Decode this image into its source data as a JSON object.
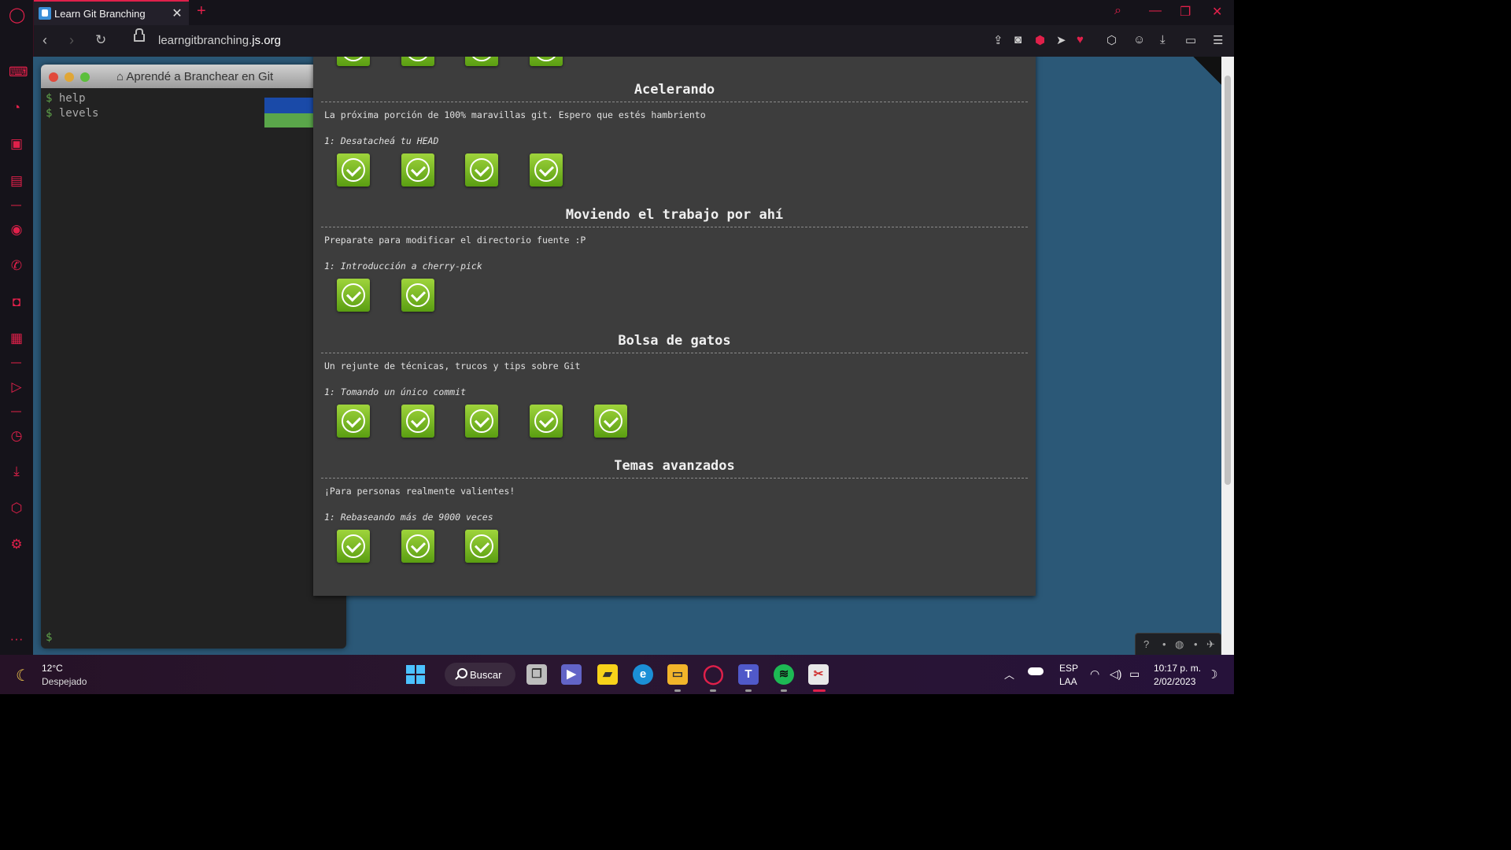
{
  "browser": {
    "tab_title": "Learn Git Branching",
    "tab_close": "✕",
    "new_tab": "+",
    "url_prefix": "learngitbranching.",
    "url_domain": "js.org",
    "accent": "#e0204a"
  },
  "terminal": {
    "title": "Aprendé a Branchear en Git",
    "lines": [
      "help",
      "levels"
    ],
    "prompt": "$"
  },
  "levels": {
    "sections": [
      {
        "title": "Acelerando",
        "desc": "La próxima porción de 100% maravillas git. Espero que estés hambriento",
        "sub": "1: Desatacheá tu HEAD",
        "completed": 4
      },
      {
        "title": "Moviendo el trabajo por ahí",
        "desc": "Preparate para modificar el directorio fuente :P",
        "sub": "1: Introducción a cherry-pick",
        "completed": 2
      },
      {
        "title": "Bolsa de gatos",
        "desc": "Un rejunte de técnicas, trucos y tips sobre Git",
        "sub": "1: Tomando un único commit",
        "completed": 5
      },
      {
        "title": "Temas avanzados",
        "desc": "¡Para personas realmente valientes!",
        "sub": "1: Rebaseando más de 9000 veces",
        "completed": 3
      }
    ],
    "top_partial_completed": 4,
    "level_color": "#7dc02a"
  },
  "taskbar": {
    "weather_temp": "12°C",
    "weather_cond": "Despejado",
    "search_label": "Buscar",
    "lang_1": "ESP",
    "lang_2": "LAA",
    "time": "10:17 p. m.",
    "date": "2/02/2023"
  }
}
